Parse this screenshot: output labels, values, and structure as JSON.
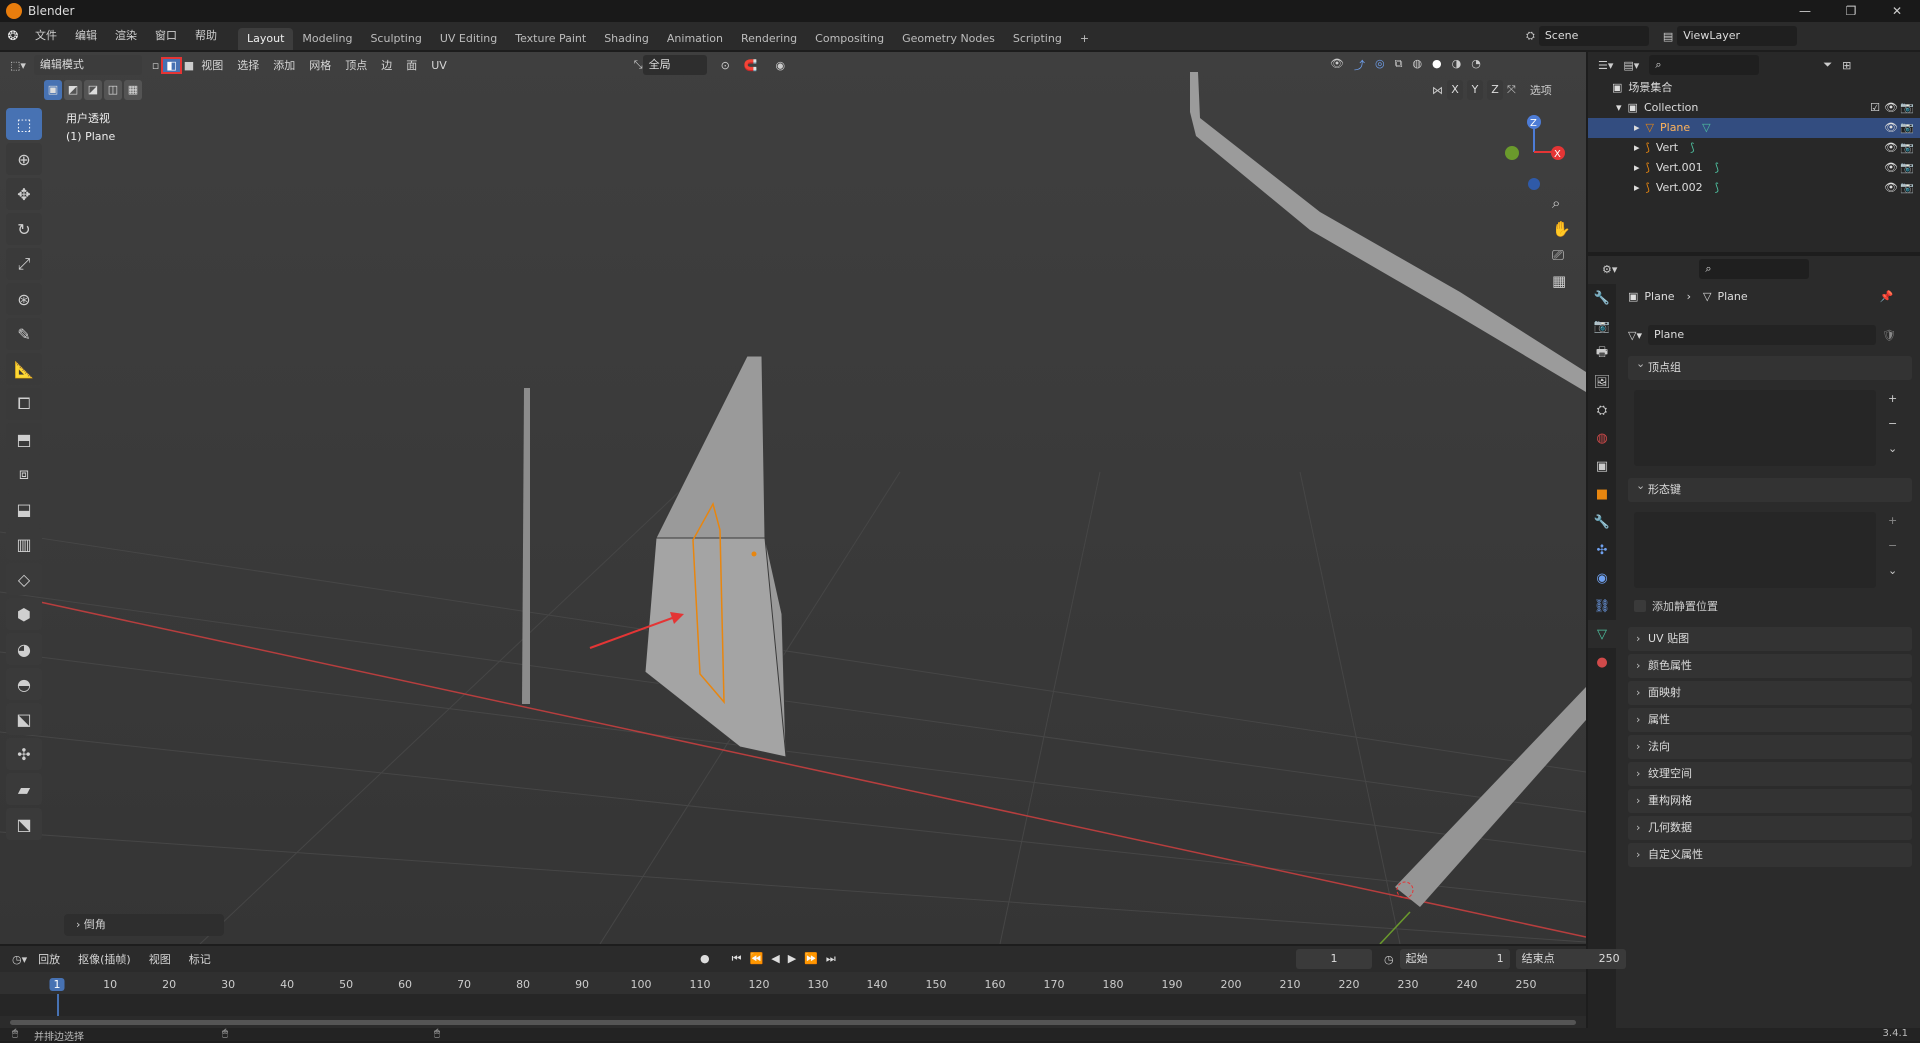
{
  "app": {
    "title": "Blender"
  },
  "menus": [
    "文件",
    "编辑",
    "渲染",
    "窗口",
    "帮助"
  ],
  "workspaces": [
    "Layout",
    "Modeling",
    "Sculpting",
    "UV Editing",
    "Texture Paint",
    "Shading",
    "Animation",
    "Rendering",
    "Compositing",
    "Geometry Nodes",
    "Scripting"
  ],
  "active_workspace": "Layout",
  "scene": {
    "name": "Scene",
    "view_layer": "ViewLayer"
  },
  "viewport_header": {
    "mode": "编辑模式",
    "menus": [
      "视图",
      "选择",
      "添加",
      "网格",
      "顶点",
      "边",
      "面",
      "UV"
    ],
    "transform_orientation": "全局",
    "options_label": "选项",
    "axes": [
      "X",
      "Y",
      "Z"
    ]
  },
  "viewport": {
    "view_name": "用户透视",
    "object_label": "(1) Plane",
    "last_op_panel": "倒角",
    "colors": {
      "background": "#3e3e3e",
      "selection": "#e8860f",
      "annotation_arrow": "#e43535",
      "x_axis": "#b73e3e",
      "y_axis": "#6a9a2c"
    }
  },
  "outliner": {
    "root": "场景集合",
    "collection": "Collection",
    "items": [
      {
        "name": "Plane",
        "selected": true
      },
      {
        "name": "Vert",
        "selected": false
      },
      {
        "name": "Vert.001",
        "selected": false
      },
      {
        "name": "Vert.002",
        "selected": false
      }
    ]
  },
  "properties": {
    "breadcrumb": [
      "Plane",
      "Plane"
    ],
    "data_name": "Plane",
    "vertex_groups": "顶点组",
    "shape_keys": "形态键",
    "relative_label": "添加静置位置",
    "panels": [
      "UV 贴图",
      "颜色属性",
      "面映射",
      "属性",
      "法向",
      "纹理空间",
      "重构网格",
      "几何数据",
      "自定义属性"
    ]
  },
  "timeline": {
    "menus": [
      "回放",
      "抠像(插帧)",
      "视图",
      "标记"
    ],
    "current_frame": "1",
    "start_label": "起始",
    "start": "1",
    "end_label": "结束点",
    "end": "250",
    "ticks": [
      "1",
      "10",
      "20",
      "30",
      "40",
      "50",
      "60",
      "70",
      "80",
      "90",
      "100",
      "110",
      "120",
      "130",
      "140",
      "150",
      "160",
      "170",
      "180",
      "190",
      "200",
      "210",
      "220",
      "230",
      "240",
      "250"
    ]
  },
  "status": {
    "hint": "并排边选择",
    "version": "3.4.1"
  }
}
